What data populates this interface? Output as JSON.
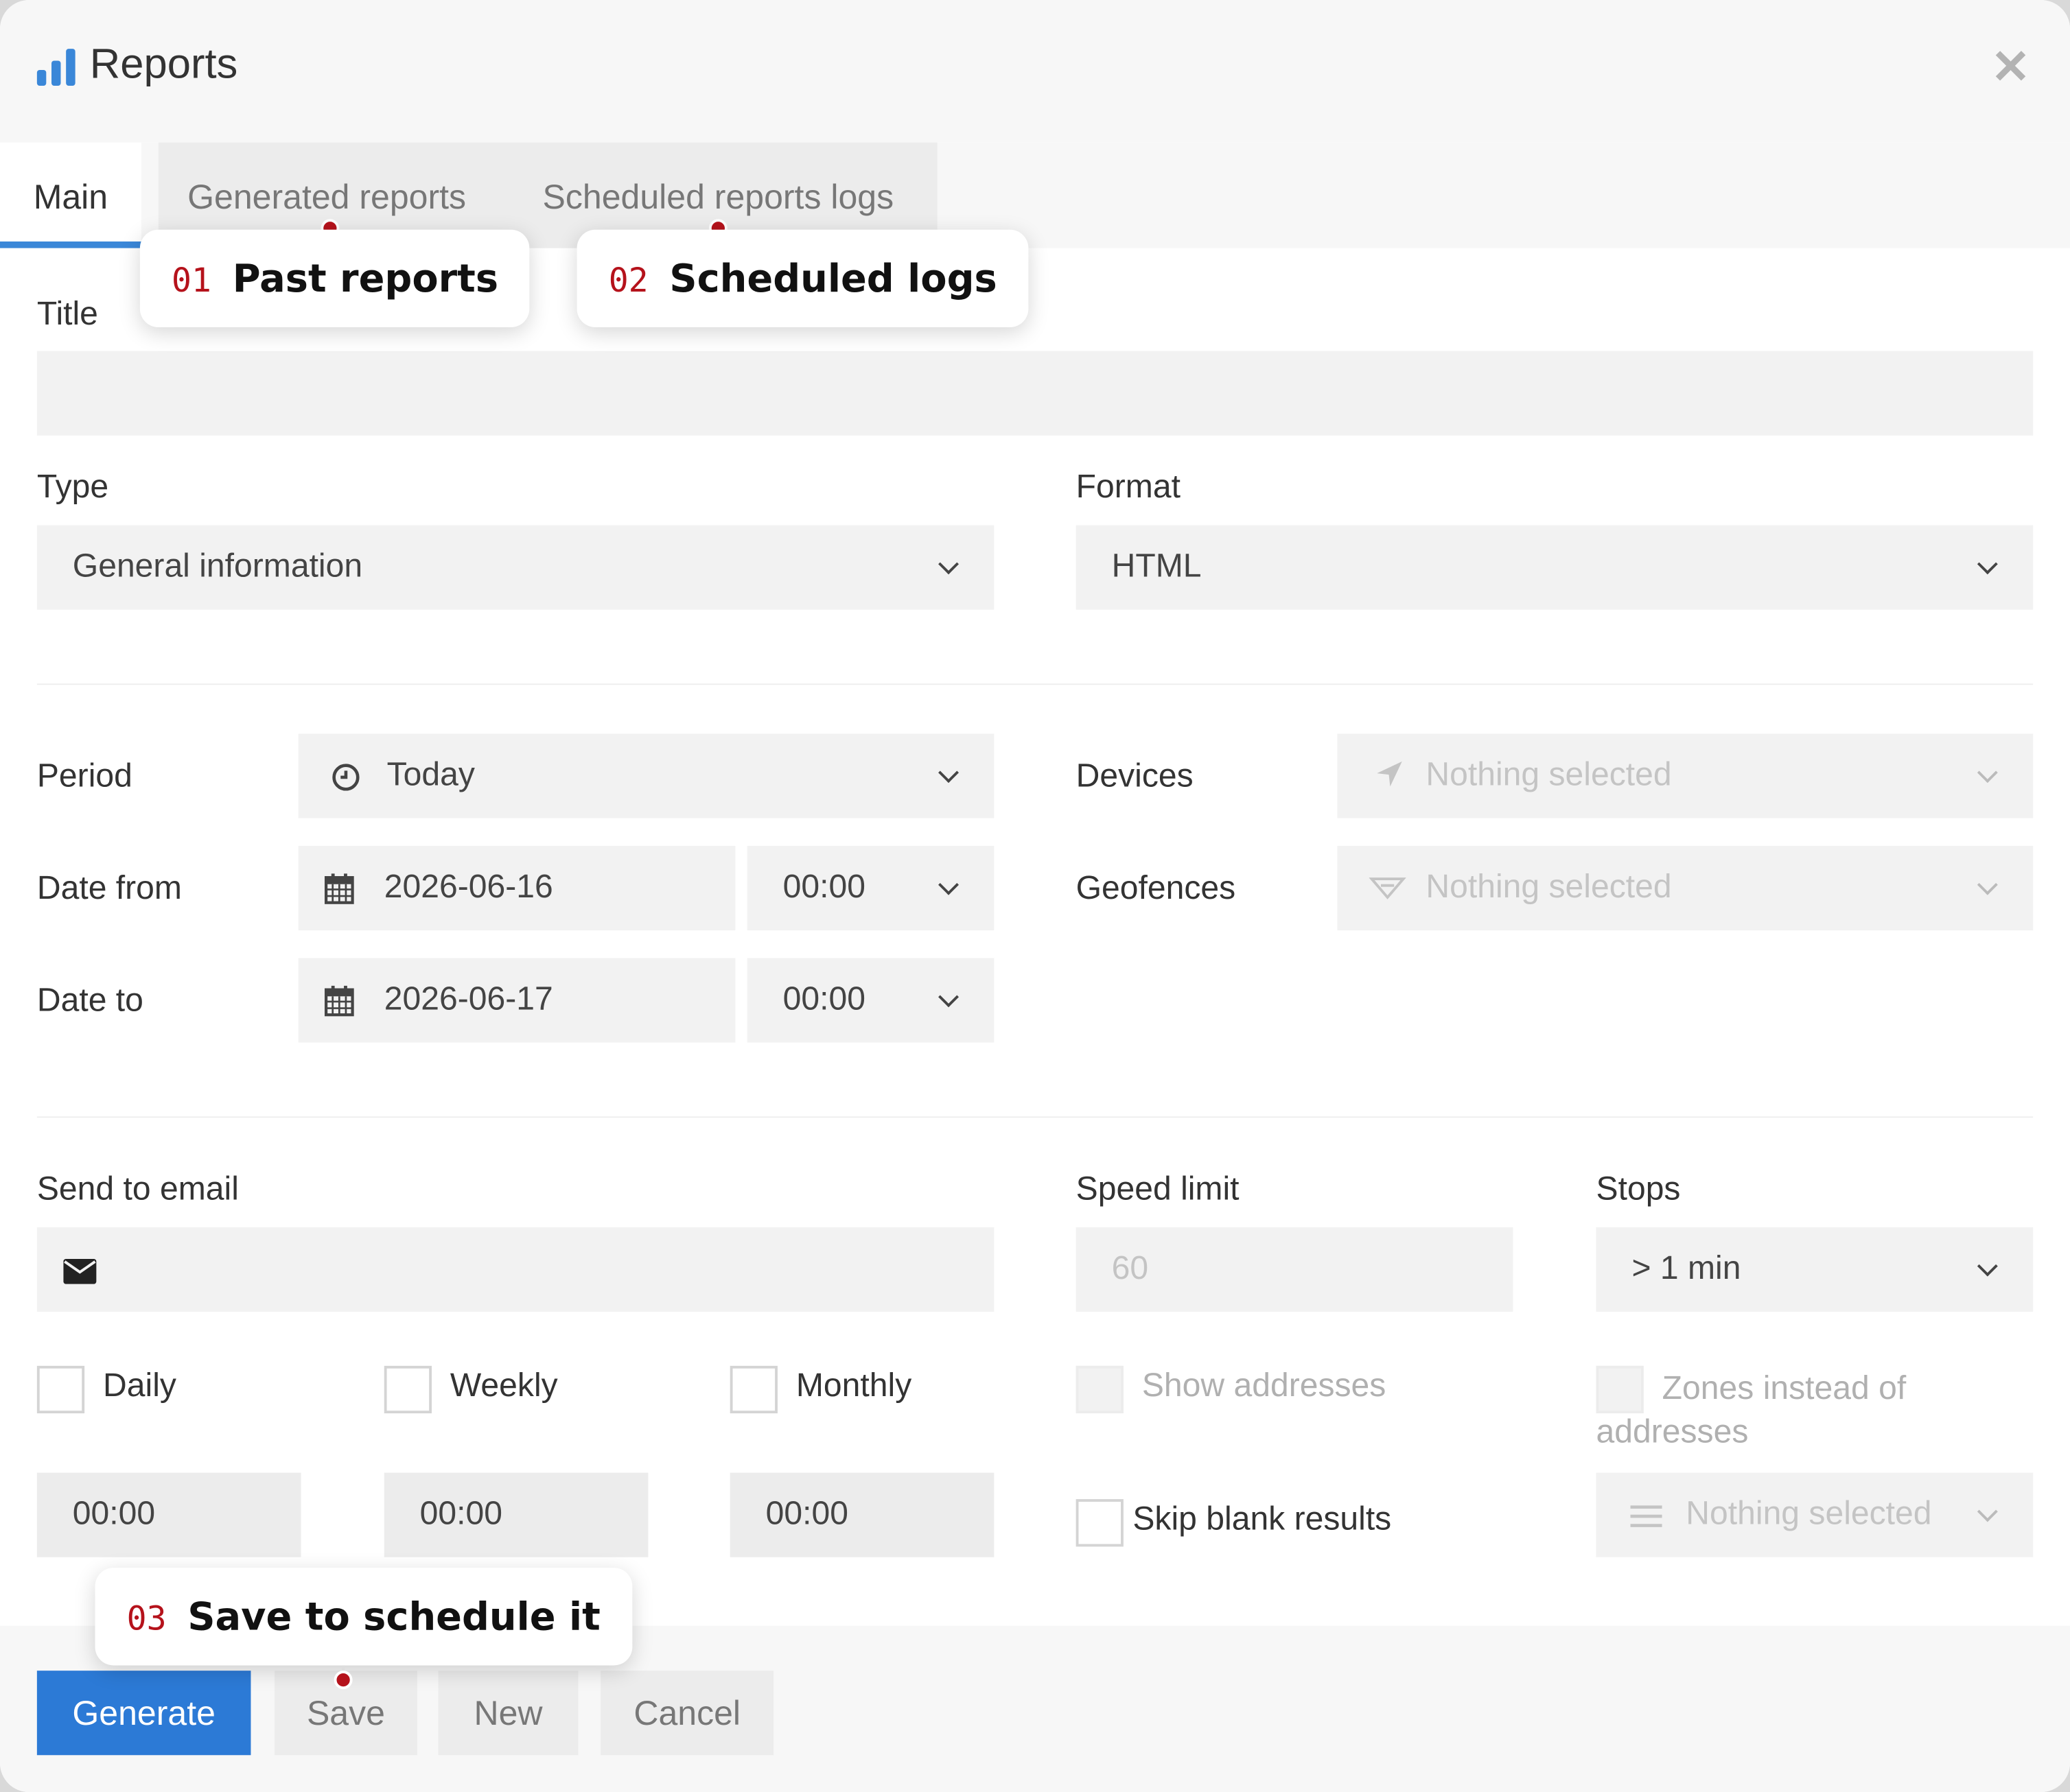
{
  "window": {
    "title": "Reports",
    "close_icon": "close-icon"
  },
  "tabs": [
    "Main",
    "Generated reports",
    "Scheduled reports logs"
  ],
  "form": {
    "title_label": "Title",
    "title_value": "",
    "type_label": "Type",
    "type_value": "General information",
    "format_label": "Format",
    "format_value": "HTML",
    "period_label": "Period",
    "period_value": "Today",
    "date_from_label": "Date from",
    "date_from_value": "2026-06-16",
    "date_from_time": "00:00",
    "date_to_label": "Date to",
    "date_to_value": "2026-06-17",
    "date_to_time": "00:00",
    "devices_label": "Devices",
    "devices_value": "Nothing selected",
    "geofences_label": "Geofences",
    "geofences_value": "Nothing selected",
    "send_email_label": "Send to email",
    "send_email_value": "",
    "speed_limit_label": "Speed limit",
    "speed_limit_placeholder": "60",
    "stops_label": "Stops",
    "stops_value": "> 1 min",
    "daily_label": "Daily",
    "weekly_label": "Weekly",
    "monthly_label": "Monthly",
    "daily_time": "00:00",
    "weekly_time": "00:00",
    "monthly_time": "00:00",
    "show_addresses_label": "Show addresses",
    "zones_label": "Zones instead of addresses",
    "skip_blank_label": "Skip blank results",
    "zones_select_value": "Nothing selected"
  },
  "buttons": {
    "generate": "Generate",
    "save": "Save",
    "new": "New",
    "cancel": "Cancel"
  },
  "callouts": [
    {
      "num": "01",
      "text": "Past reports"
    },
    {
      "num": "02",
      "text": "Scheduled logs"
    },
    {
      "num": "03",
      "text": "Save to schedule it"
    }
  ],
  "colors": {
    "accent": "#2c7ad6",
    "callout_number": "#b5121b"
  }
}
